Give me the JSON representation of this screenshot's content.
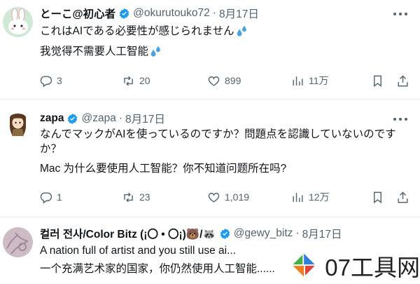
{
  "tweets": [
    {
      "name": "とーこ@初心者",
      "handle": "@okurutouko72",
      "dot": "·",
      "date": "8月17日",
      "line1": "これはAIである必要性が感じられません",
      "line2": "我觉得不需要人工智能",
      "replies": "3",
      "retweets": "20",
      "likes": "899",
      "views": "11万"
    },
    {
      "name": "zapa",
      "handle": "@zapa",
      "dot": "·",
      "date": "8月17日",
      "line1": "なんでマックがAIを使っているのですか？問題点を認識していないのです",
      "line1b": "か？",
      "line2": "Mac 为什么要使用人工智能？你不知道问题所在吗?",
      "replies": "1",
      "retweets": "23",
      "likes": "1,019",
      "views": "12万"
    },
    {
      "name": "컬러 전사/Color Bitz (¡〇 • 〇¡)🐻/🦝",
      "handle": "@gewy_bitz",
      "dot": "·",
      "date": "8月17日",
      "line1": "A nation full of artist and you still use ai...",
      "line2": "一个充满艺术家的国家，你仍然使用人工智能......"
    }
  ],
  "watermark": {
    "text": "07工具网"
  },
  "colors": {
    "accent": "#1d9bf0",
    "muted": "#536471",
    "text": "#0f1419",
    "drop": "#4aa3df"
  },
  "icons": [
    "verified-badge-icon",
    "sweat-drops-emoji-icon",
    "reply-icon",
    "retweet-icon",
    "like-icon",
    "views-icon",
    "bookmark-icon",
    "share-icon",
    "more-icon"
  ]
}
